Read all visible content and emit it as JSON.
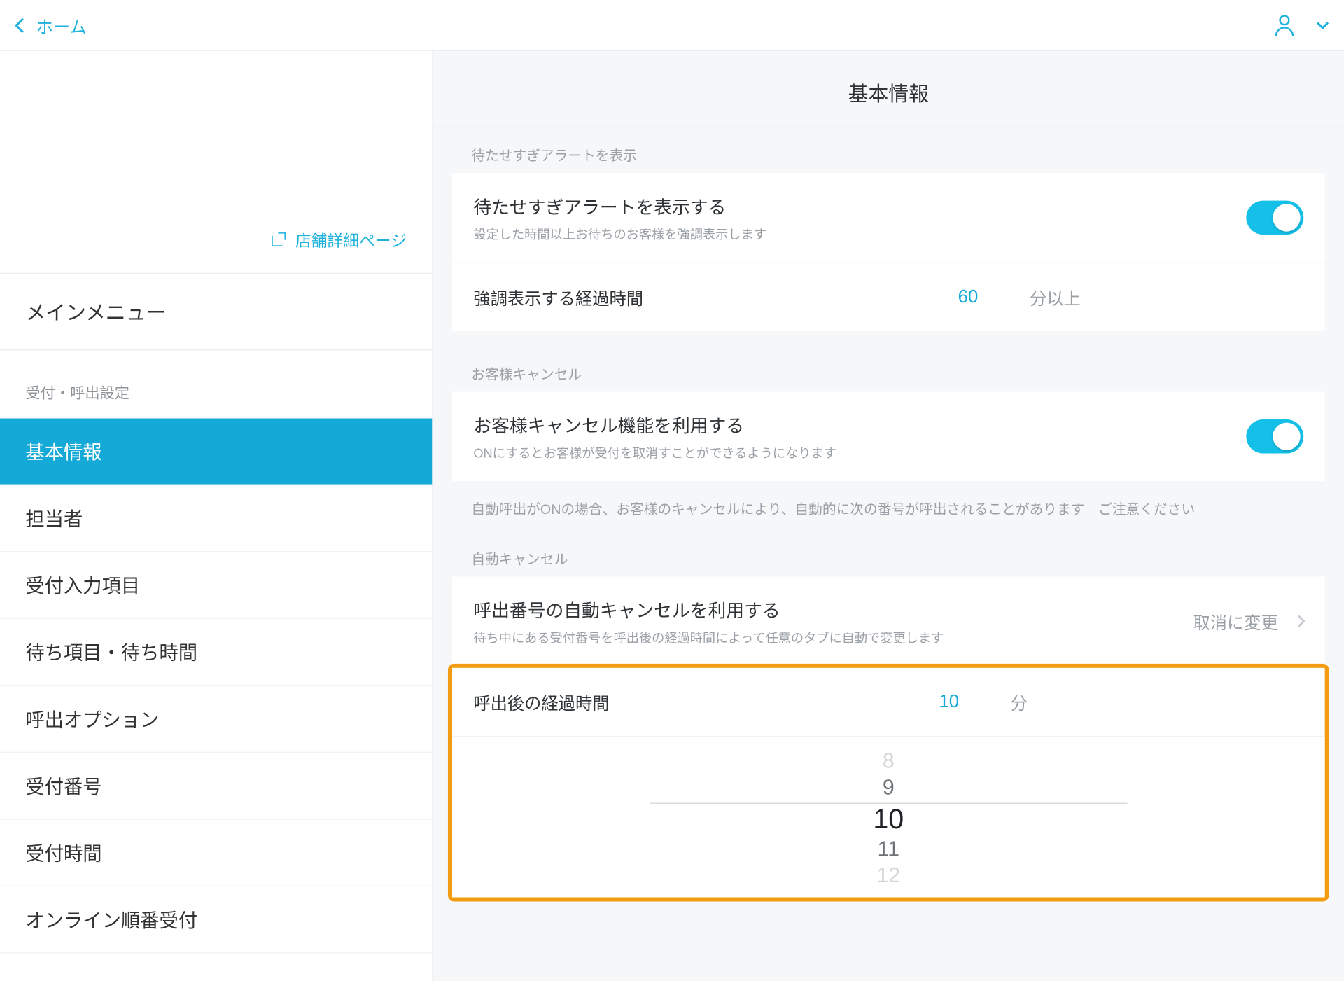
{
  "topbar": {
    "home_label": "ホーム"
  },
  "sidebar": {
    "store_detail_link": "店舗詳細ページ",
    "main_menu_label": "メインメニュー",
    "section_label": "受付・呼出設定",
    "items": [
      "基本情報",
      "担当者",
      "受付入力項目",
      "待ち項目・待ち時間",
      "呼出オプション",
      "受付番号",
      "受付時間",
      "オンライン順番受付"
    ]
  },
  "page": {
    "title": "基本情報"
  },
  "alert_section": {
    "header": "待たせすぎアラートを表示",
    "row1_title": "待たせすぎアラートを表示する",
    "row1_sub": "設定した時間以上お待ちのお客様を強調表示します",
    "row2_label": "強調表示する経過時間",
    "row2_value": "60",
    "row2_unit": "分以上"
  },
  "cancel_section": {
    "header": "お客様キャンセル",
    "row1_title": "お客様キャンセル機能を利用する",
    "row1_sub": "ONにするとお客様が受付を取消すことができるようになります",
    "note": "自動呼出がONの場合、お客様のキャンセルにより、自動的に次の番号が呼出されることがあります　ご注意ください"
  },
  "auto_cancel": {
    "header": "自動キャンセル",
    "row1_title": "呼出番号の自動キャンセルを利用する",
    "row1_sub": "待ち中にある受付番号を呼出後の経過時間によって任意のタブに自動で変更します",
    "row1_value_label": "取消に変更",
    "row2_label": "呼出後の経過時間",
    "row2_value": "10",
    "row2_unit": "分",
    "picker_values": [
      "8",
      "9",
      "10",
      "11",
      "12"
    ]
  }
}
